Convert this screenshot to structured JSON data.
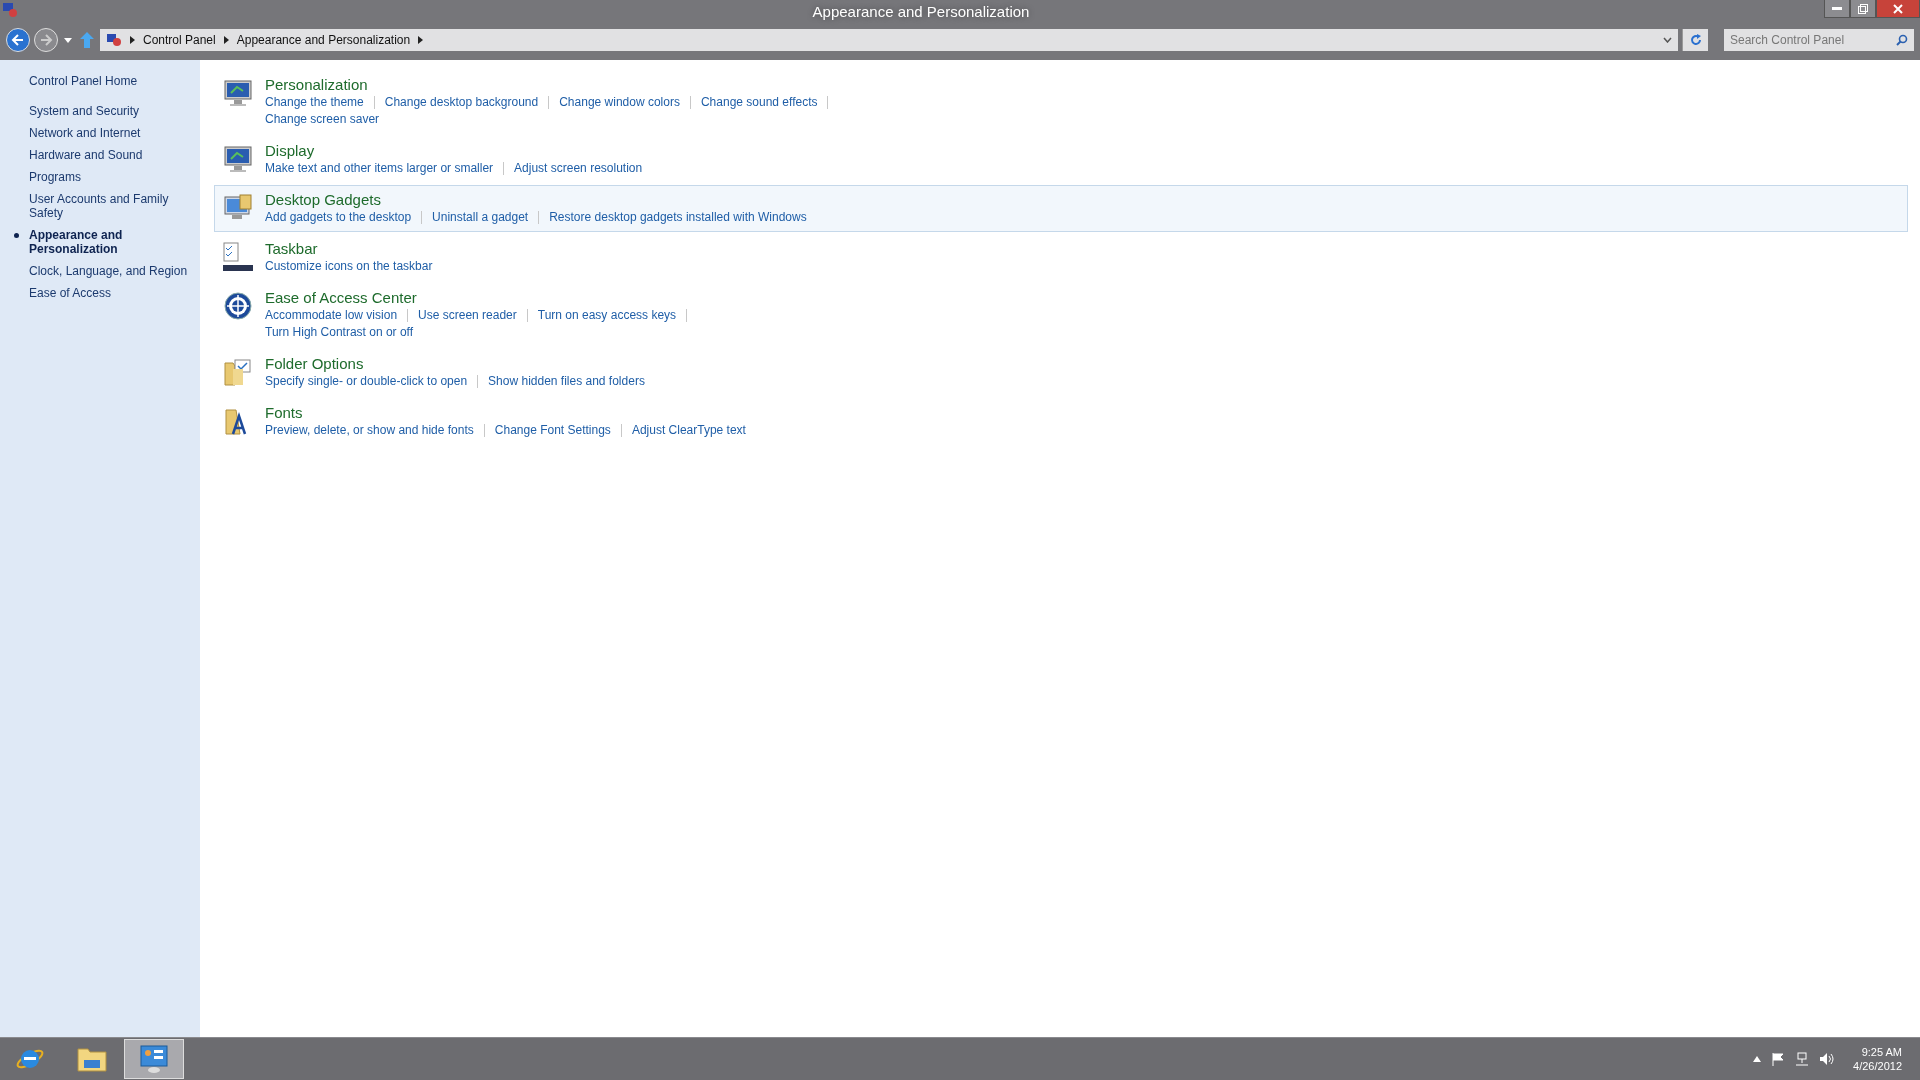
{
  "window": {
    "title": "Appearance and Personalization"
  },
  "address_bar": {
    "crumbs": [
      "Control Panel",
      "Appearance and Personalization"
    ],
    "search": {
      "placeholder": "Search Control Panel"
    }
  },
  "sidebar": {
    "home": "Control Panel Home",
    "items": [
      {
        "label": "System and Security",
        "selected": false
      },
      {
        "label": "Network and Internet",
        "selected": false
      },
      {
        "label": "Hardware and Sound",
        "selected": false
      },
      {
        "label": "Programs",
        "selected": false
      },
      {
        "label": "User Accounts and Family Safety",
        "selected": false
      },
      {
        "label": "Appearance and Personalization",
        "selected": true
      },
      {
        "label": "Clock, Language, and Region",
        "selected": false
      },
      {
        "label": "Ease of Access",
        "selected": false
      }
    ]
  },
  "categories": [
    {
      "title": "Personalization",
      "hovered": false,
      "links": [
        "Change the theme",
        "Change desktop background",
        "Change window colors",
        "Change sound effects",
        "Change screen saver"
      ]
    },
    {
      "title": "Display",
      "hovered": false,
      "links": [
        "Make text and other items larger or smaller",
        "Adjust screen resolution"
      ]
    },
    {
      "title": "Desktop Gadgets",
      "hovered": true,
      "links": [
        "Add gadgets to the desktop",
        "Uninstall a gadget",
        "Restore desktop gadgets installed with Windows"
      ]
    },
    {
      "title": "Taskbar",
      "hovered": false,
      "links": [
        "Customize icons on the taskbar"
      ]
    },
    {
      "title": "Ease of Access Center",
      "hovered": false,
      "links": [
        "Accommodate low vision",
        "Use screen reader",
        "Turn on easy access keys",
        "Turn High Contrast on or off"
      ]
    },
    {
      "title": "Folder Options",
      "hovered": false,
      "links": [
        "Specify single- or double-click to open",
        "Show hidden files and folders"
      ]
    },
    {
      "title": "Fonts",
      "hovered": false,
      "links": [
        "Preview, delete, or show and hide fonts",
        "Change Font Settings",
        "Adjust ClearType text"
      ]
    }
  ],
  "taskbar": {
    "apps": [
      {
        "selected": false
      },
      {
        "selected": false
      },
      {
        "selected": true
      }
    ],
    "time": "9:25 AM",
    "date": "4/26/2012"
  }
}
